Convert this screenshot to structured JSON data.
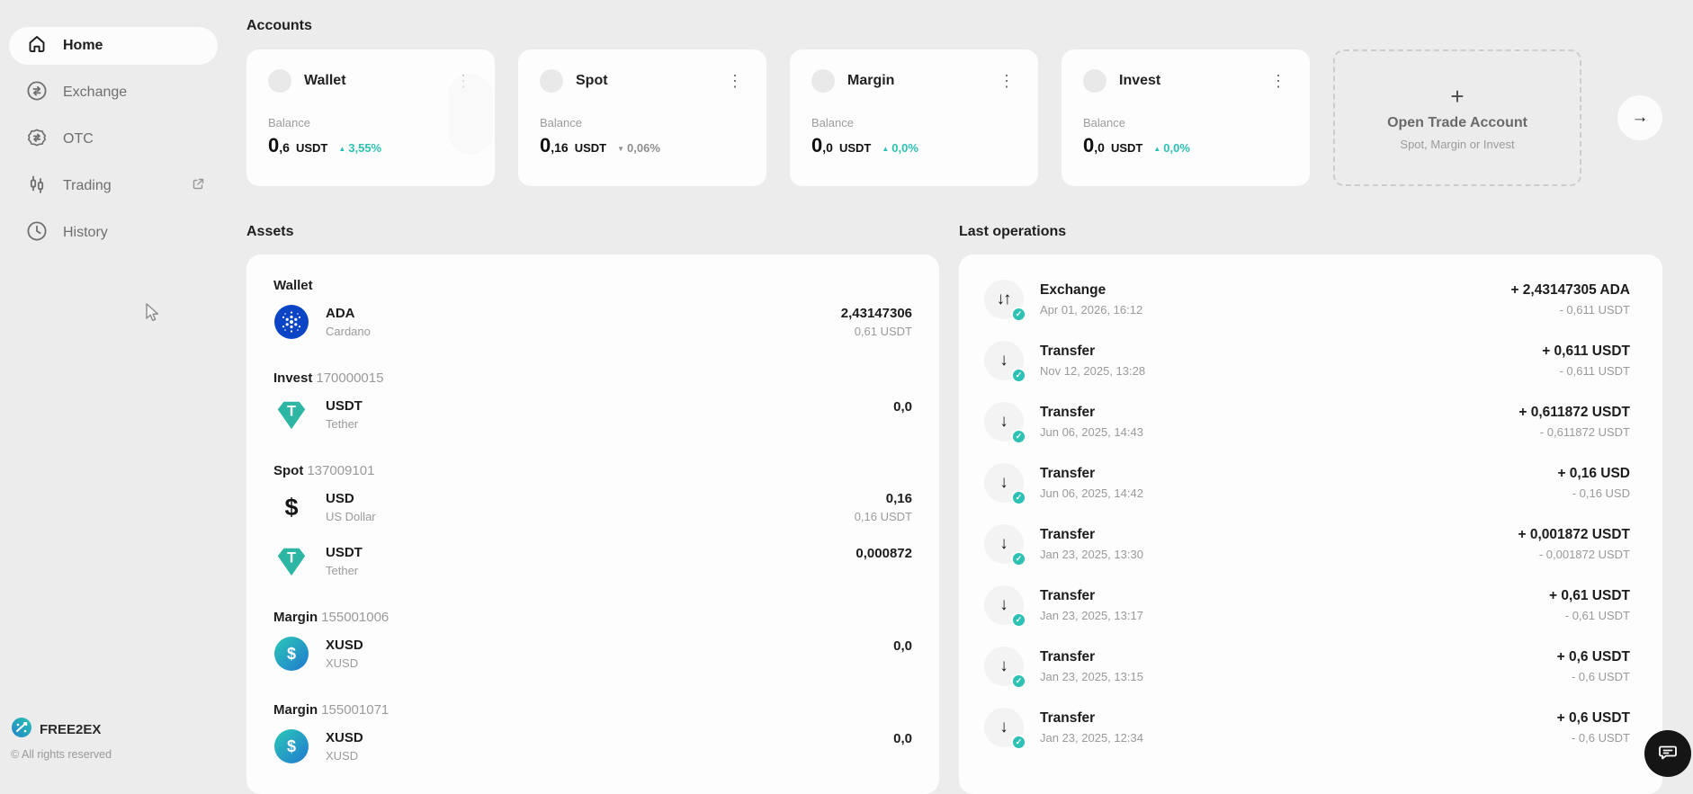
{
  "sidebar": {
    "items": [
      {
        "label": "Home",
        "icon": "home",
        "active": true
      },
      {
        "label": "Exchange",
        "icon": "exchange-arrows"
      },
      {
        "label": "OTC",
        "icon": "otc-badge"
      },
      {
        "label": "Trading",
        "icon": "candlestick",
        "external": true
      },
      {
        "label": "History",
        "icon": "clock"
      }
    ],
    "footer": {
      "brand": "FREE2EX",
      "copyright": "© All rights reserved"
    }
  },
  "accounts": {
    "title": "Accounts",
    "cards": [
      {
        "name": "Wallet",
        "balance_label": "Balance",
        "amount_int": "0",
        "amount_frac": ",6",
        "currency": "USDT",
        "change": {
          "arrow": "▲",
          "value": "3,55%",
          "tone": "teal"
        }
      },
      {
        "name": "Spot",
        "balance_label": "Balance",
        "amount_int": "0",
        "amount_frac": ",16",
        "currency": "USDT",
        "change": {
          "arrow": "▼",
          "value": "0,06%",
          "tone": "gray"
        }
      },
      {
        "name": "Margin",
        "balance_label": "Balance",
        "amount_int": "0",
        "amount_frac": ",0",
        "currency": "USDT",
        "change": {
          "arrow": "▲",
          "value": "0,0%",
          "tone": "teal"
        }
      },
      {
        "name": "Invest",
        "balance_label": "Balance",
        "amount_int": "0",
        "amount_frac": ",0",
        "currency": "USDT",
        "change": {
          "arrow": "▲",
          "value": "0,0%",
          "tone": "teal"
        }
      }
    ],
    "open_card": {
      "plus": "+",
      "title": "Open Trade Account",
      "subtitle": "Spot, Margin or Invest"
    },
    "next_arrow": "→"
  },
  "assets": {
    "title": "Assets",
    "groups": [
      {
        "label": "Wallet",
        "account_number": "",
        "items": [
          {
            "icon": "ada",
            "symbol": "ADA",
            "name": "Cardano",
            "amount": "2,43147306",
            "sub": "0,61 USDT"
          }
        ]
      },
      {
        "label": "Invest",
        "account_number": "170000015",
        "items": [
          {
            "icon": "usdt",
            "symbol": "USDT",
            "name": "Tether",
            "amount": "0,0",
            "sub": ""
          }
        ]
      },
      {
        "label": "Spot",
        "account_number": "137009101",
        "items": [
          {
            "icon": "usd",
            "symbol": "USD",
            "name": "US Dollar",
            "amount": "0,16",
            "sub": "0,16 USDT"
          },
          {
            "icon": "usdt",
            "symbol": "USDT",
            "name": "Tether",
            "amount": "0,000872",
            "sub": ""
          }
        ]
      },
      {
        "label": "Margin",
        "account_number": "155001006",
        "items": [
          {
            "icon": "xusd",
            "symbol": "XUSD",
            "name": "XUSD",
            "amount": "0,0",
            "sub": ""
          }
        ]
      },
      {
        "label": "Margin",
        "account_number": "155001071",
        "items": [
          {
            "icon": "xusd",
            "symbol": "XUSD",
            "name": "XUSD",
            "amount": "0,0",
            "sub": ""
          }
        ]
      }
    ]
  },
  "operations": {
    "title": "Last operations",
    "items": [
      {
        "type": "Exchange",
        "icon_glyph": "↓↑",
        "date": "Apr 01, 2026, 16:12",
        "amount": "+ 2,43147305 ADA",
        "sub": "- 0,611 USDT"
      },
      {
        "type": "Transfer",
        "icon_glyph": "↓",
        "date": "Nov 12, 2025, 13:28",
        "amount": "+ 0,611 USDT",
        "sub": "- 0,611 USDT"
      },
      {
        "type": "Transfer",
        "icon_glyph": "↓",
        "date": "Jun 06, 2025, 14:43",
        "amount": "+ 0,611872 USDT",
        "sub": "- 0,611872 USDT"
      },
      {
        "type": "Transfer",
        "icon_glyph": "↓",
        "date": "Jun 06, 2025, 14:42",
        "amount": "+ 0,16 USD",
        "sub": "- 0,16 USD"
      },
      {
        "type": "Transfer",
        "icon_glyph": "↓",
        "date": "Jan 23, 2025, 13:30",
        "amount": "+ 0,001872 USDT",
        "sub": "- 0,001872 USDT"
      },
      {
        "type": "Transfer",
        "icon_glyph": "↓",
        "date": "Jan 23, 2025, 13:17",
        "amount": "+ 0,61 USDT",
        "sub": "- 0,61 USDT"
      },
      {
        "type": "Transfer",
        "icon_glyph": "↓",
        "date": "Jan 23, 2025, 13:15",
        "amount": "+ 0,6 USDT",
        "sub": "- 0,6 USDT"
      },
      {
        "type": "Transfer",
        "icon_glyph": "↓",
        "date": "Jan 23, 2025, 12:34",
        "amount": "+ 0,6 USDT",
        "sub": "- 0,6 USDT"
      }
    ],
    "status_check": "✓"
  },
  "colors": {
    "accent_teal": "#2cc1b2",
    "ada_blue": "#0b45c5",
    "usdt_teal": "#2eb6a4",
    "muted_gray": "#9a9a9a",
    "page_background": "#ececec",
    "card_background": "#fdfdfd"
  }
}
